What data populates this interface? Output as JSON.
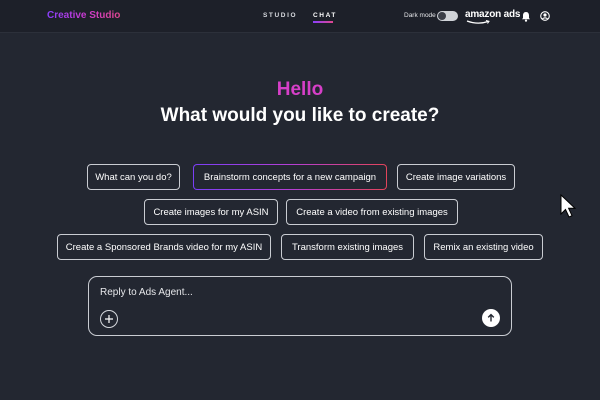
{
  "header": {
    "brand": "Creative Studio",
    "tabs": [
      {
        "label": "STUDIO",
        "active": false
      },
      {
        "label": "CHAT",
        "active": true
      }
    ],
    "dark_mode_label": "Dark mode",
    "dark_mode_on": false,
    "logo_text": "amazon ads",
    "icons": [
      "bell-icon",
      "user-icon"
    ]
  },
  "main": {
    "greeting": "Hello",
    "headline": "What would you like to create?",
    "suggestions": [
      "What can you do?",
      "Brainstorm concepts for a new campaign",
      "Create image variations",
      "Create images for my ASIN",
      "Create a video from existing images",
      "Create a Sponsored Brands video for my ASIN",
      "Transform existing images",
      "Remix an existing video"
    ]
  },
  "composer": {
    "placeholder": "Reply to Ads Agent...",
    "add_icon": "plus-icon",
    "send_icon": "arrow-up-icon"
  },
  "colors": {
    "background": "#232731",
    "topbar": "#1d2029",
    "greeting": "#d63fc8",
    "accent_gradient_start": "#8a3ffc",
    "accent_gradient_end": "#e0468f"
  }
}
